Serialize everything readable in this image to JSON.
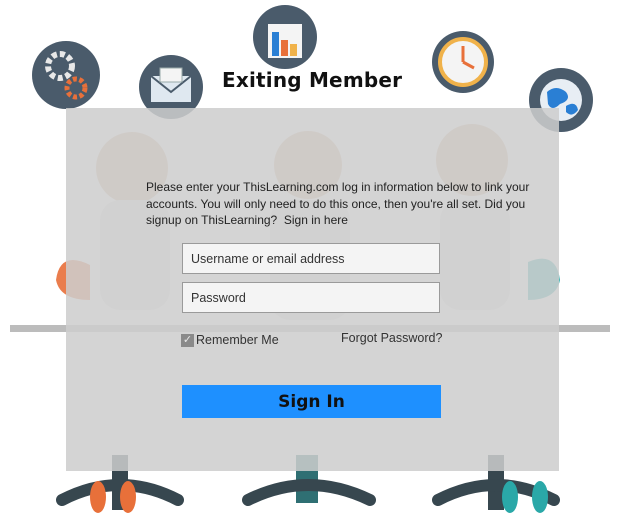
{
  "page": {
    "title": "Exiting Member"
  },
  "intro": {
    "text": "Please enter your ThisLearning.com log in information below to link your accounts. You will only need to do this once, then you're all set. Did you signup on ThisLearning?",
    "signin_link": "Sign in here"
  },
  "form": {
    "username_placeholder": "Username or email address",
    "password_placeholder": "Password",
    "remember_label": "Remember Me",
    "remember_checked": true,
    "forgot_label": "Forgot Password?",
    "signin_label": "Sign In"
  },
  "colors": {
    "accent": "#1e90ff",
    "overlay": "#cdcdcd",
    "icon_circle": "#4a5b6b",
    "chair_teal": "#2aa8a8",
    "chair_dark": "#37474f",
    "person_orange": "#e8703a"
  },
  "icons": [
    "gear-icon",
    "mail-icon",
    "bar-chart-icon",
    "clock-icon",
    "globe-icon"
  ]
}
